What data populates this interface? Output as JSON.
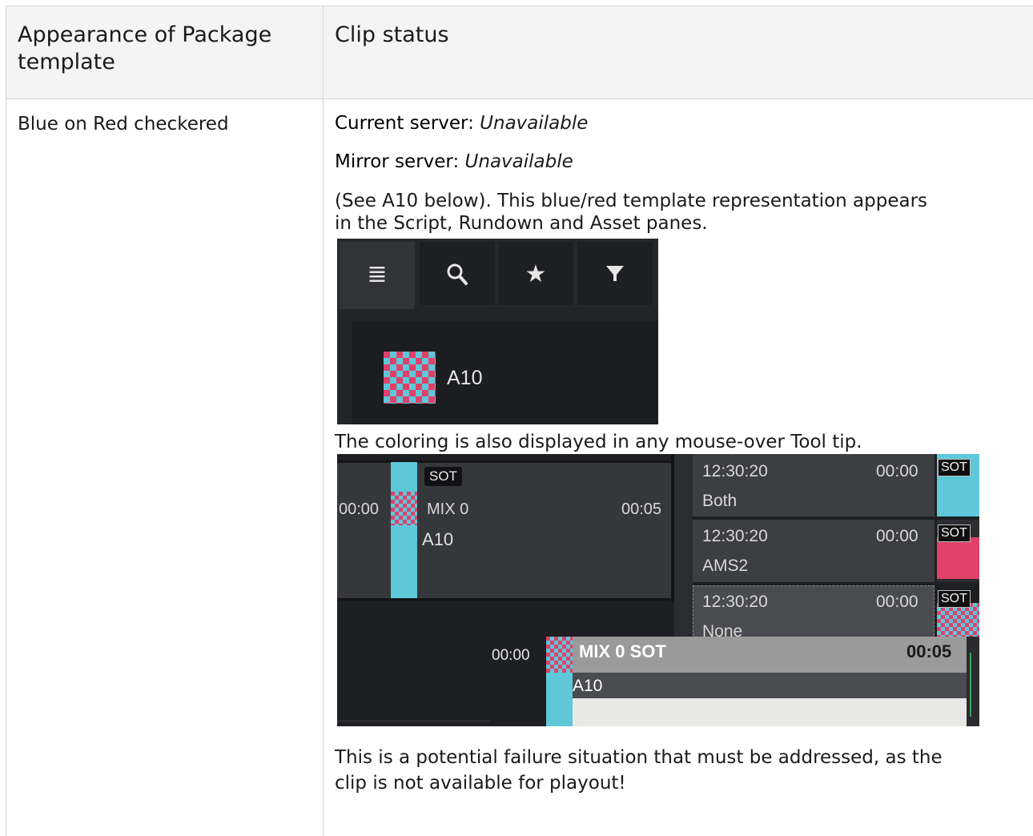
{
  "table": {
    "headers": [
      "Appearance of Package template",
      "Clip status"
    ],
    "header_left_lines": [
      "Appearance of Package",
      "template"
    ],
    "row": {
      "appearance": "Blue on Red checkered",
      "current_server_label": "Current server",
      "current_server_value": "Unavailable",
      "mirror_server_label": "Mirror server",
      "mirror_server_value": "Unavailable",
      "note_line1": "(See A10 below). This blue/red template representation appears",
      "note_line2": "in the Script, Rundown and Asset panes.",
      "tooltip_note": "The coloring is also displayed in any mouse-over Tool tip.",
      "warning_line1": "This is a potential failure situation that must be addressed, as the",
      "warning_line2": "clip is not available for playout!"
    }
  },
  "screenshot_asset_pane": {
    "tabs": [
      {
        "icon": "list-icon",
        "glyph": "≣",
        "active": true
      },
      {
        "icon": "search-icon",
        "glyph": "⚲",
        "active": false
      },
      {
        "icon": "star-icon",
        "glyph": "★",
        "active": false
      },
      {
        "icon": "filter-icon",
        "glyph": "▼",
        "active": false
      }
    ],
    "item_label": "A10",
    "colors": {
      "checker_blue": "#5ec7d8",
      "checker_red": "#e0406a",
      "background": "#232427"
    }
  },
  "screenshot_tooltip": {
    "clip": {
      "time_left": "00:00",
      "sot": "SOT",
      "mix": "MIX 0",
      "label": "A10",
      "duration": "00:05"
    },
    "rundown_rows": [
      {
        "time": "12:30:20",
        "dur": "00:00",
        "server": "Both",
        "tag": "SOT"
      },
      {
        "time": "12:30:20",
        "dur": "00:00",
        "server": "AMS2",
        "tag": "SOT"
      },
      {
        "time": "12:30:20",
        "dur": "00:00",
        "server": "None",
        "tag": "SOT"
      }
    ],
    "tooltip": {
      "time": "00:00",
      "title": "MIX 0  SOT",
      "duration": "00:05",
      "label": "A10"
    }
  }
}
